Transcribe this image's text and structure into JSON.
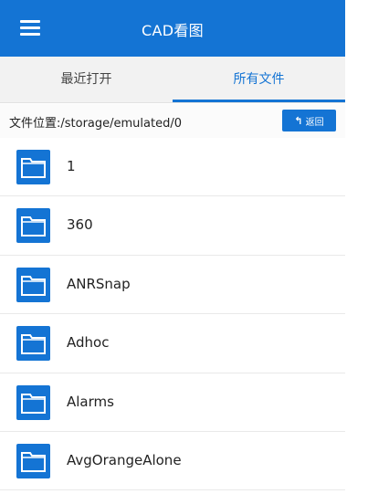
{
  "header": {
    "title": "CAD看图",
    "menu_icon": "hamburger-menu-icon"
  },
  "tabs": [
    {
      "label": "最近打开"
    },
    {
      "label": "所有文件",
      "selected": true
    }
  ],
  "pathbar": {
    "path": "文件位置:/storage/emulated/0",
    "back_label": "返回",
    "back_icon": "phone-back-icon"
  },
  "files": [
    {
      "name": "1",
      "icon": "folder-icon"
    },
    {
      "name": "360",
      "icon": "folder-icon"
    },
    {
      "name": "ANRSnap",
      "icon": "folder-icon"
    },
    {
      "name": "Adhoc",
      "icon": "folder-icon"
    },
    {
      "name": "Alarms",
      "icon": "folder-icon"
    },
    {
      "name": "AvgOrangeAlone",
      "icon": "folder-icon"
    }
  ],
  "colors": {
    "accent": "#1474d4",
    "tab_bg": "#f2f2f2",
    "text": "#222222"
  }
}
